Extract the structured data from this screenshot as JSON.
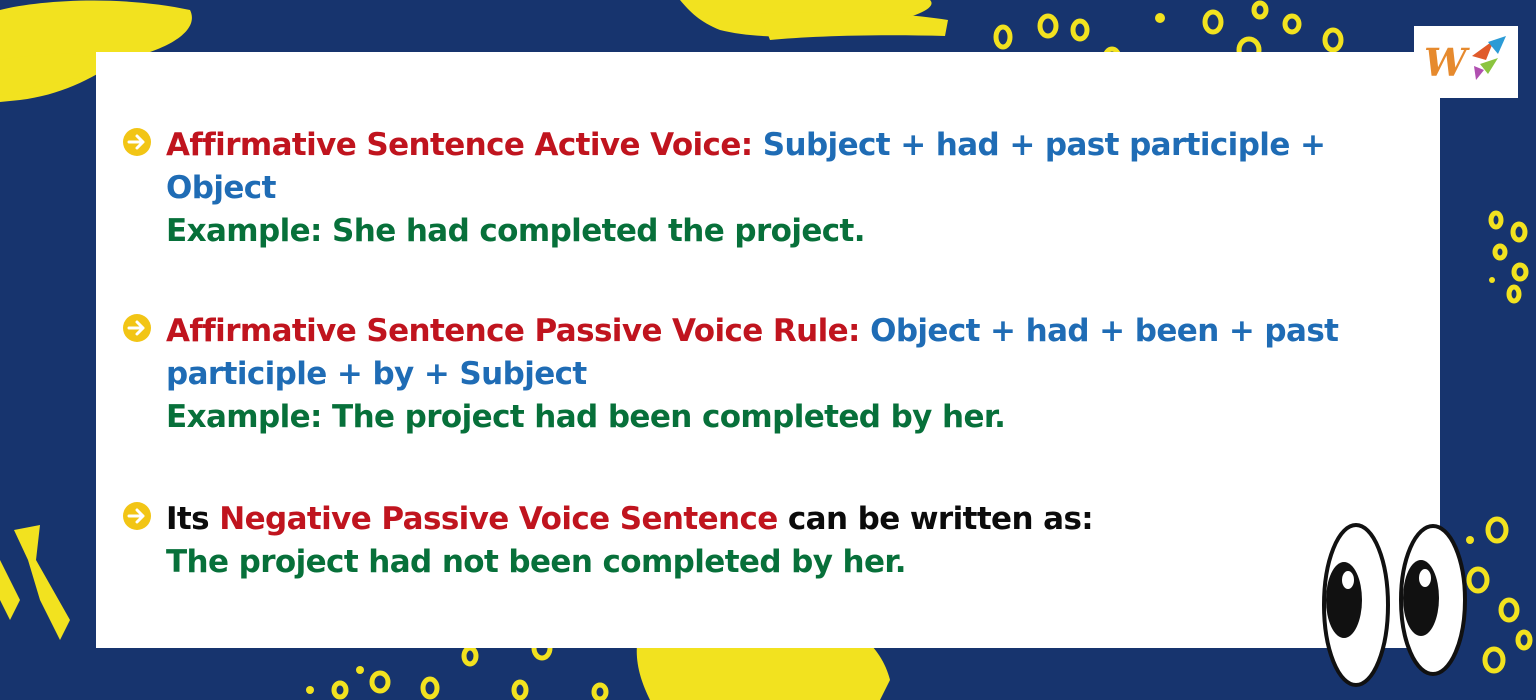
{
  "rules": [
    {
      "label": "Affirmative Sentence Active Voice:",
      "formula": "Subject + had + past participle + Object",
      "example": "Example: She had completed the project."
    },
    {
      "label": "Affirmative Sentence Passive Voice Rule:",
      "formula": "Object + had + been + past participle + by + Subject",
      "example": "Example: The project had been completed by her."
    }
  ],
  "negative": {
    "prefix": "Its",
    "highlight": "Negative Passive Voice Sentence",
    "suffix": "can be written as:",
    "example": "The project had not been completed by her."
  },
  "colors": {
    "background": "#17346e",
    "card": "#ffffff",
    "rule_label": "#c0141e",
    "formula": "#1f6cb5",
    "example": "#07703a",
    "accent_yellow": "#f2e21f"
  },
  "icons": {
    "bullet": "arrow-right-circle-icon",
    "logo": "w-brand-logo",
    "eyes": "cartoon-eyes"
  }
}
